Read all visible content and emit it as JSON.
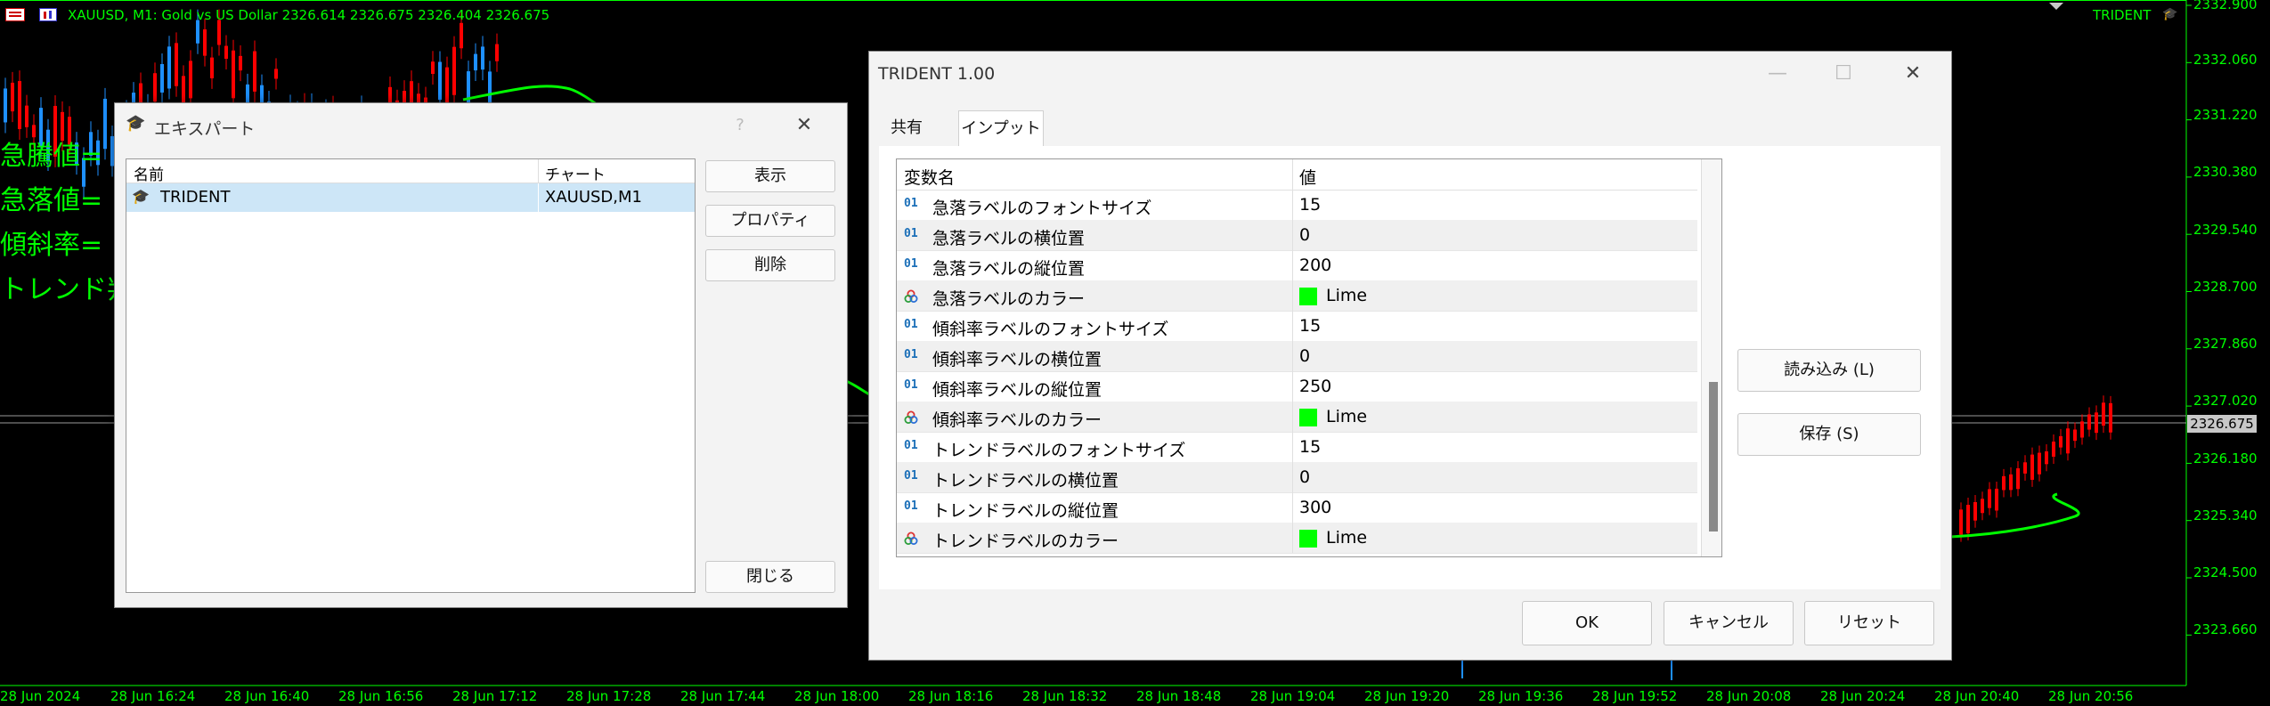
{
  "chart": {
    "title": "XAUUSD, M1:  Gold vs US Dollar  2326.614 2326.675 2326.404 2326.675",
    "indicator_label": "TRIDENT",
    "labels": [
      "急騰値=",
      "急落値=",
      "傾斜率=",
      "トレンド判"
    ],
    "y_ticks": [
      "2332.900",
      "2332.060",
      "2331.220",
      "2330.380",
      "2329.540",
      "2328.700",
      "2327.860",
      "2327.020",
      "2326.180",
      "2325.340",
      "2324.500",
      "2323.660"
    ],
    "current_price": "2326.675",
    "x_ticks": [
      "28 Jun 2024",
      "28 Jun 16:24",
      "28 Jun 16:40",
      "28 Jun 16:56",
      "28 Jun 17:12",
      "28 Jun 17:28",
      "28 Jun 17:44",
      "28 Jun 18:00",
      "28 Jun 18:16",
      "28 Jun 18:32",
      "28 Jun 18:48",
      "28 Jun 19:04",
      "28 Jun 19:20",
      "28 Jun 19:36",
      "28 Jun 19:52",
      "28 Jun 20:08",
      "28 Jun 20:24",
      "28 Jun 20:40",
      "28 Jun 20:56"
    ],
    "colors": {
      "background": "#000000",
      "bull": "#ff0000",
      "bear": "#1e90ff",
      "ma": "#00ff00",
      "text": "#00ff00"
    }
  },
  "expert_window": {
    "title": "エキスパート",
    "help": "?",
    "close": "✕",
    "columns": [
      "名前",
      "チャート"
    ],
    "rows": [
      {
        "name": "TRIDENT",
        "chart": "XAUUSD,M1"
      }
    ],
    "buttons": {
      "show": "表示",
      "properties": "プロパティ",
      "delete": "削除",
      "close": "閉じる"
    }
  },
  "trident_window": {
    "title": "TRIDENT 1.00",
    "minimize": "—",
    "maximize": "☐",
    "close": "✕",
    "tabs": [
      "共有",
      "インプット"
    ],
    "active_tab": "インプット",
    "grid_header": {
      "name": "変数名",
      "value": "値"
    },
    "rows": [
      {
        "type": "int",
        "icon": "01",
        "name": "急落ラベルのフォントサイズ",
        "value": "15"
      },
      {
        "type": "int",
        "icon": "01",
        "name": "急落ラベルの横位置",
        "value": "0"
      },
      {
        "type": "int",
        "icon": "01",
        "name": "急落ラベルの縦位置",
        "value": "200"
      },
      {
        "type": "color",
        "icon": "palette-icon",
        "name": "急落ラベルのカラー",
        "value": "Lime",
        "color": "#00ff00"
      },
      {
        "type": "int",
        "icon": "01",
        "name": "傾斜率ラベルのフォントサイズ",
        "value": "15"
      },
      {
        "type": "int",
        "icon": "01",
        "name": "傾斜率ラベルの横位置",
        "value": "0"
      },
      {
        "type": "int",
        "icon": "01",
        "name": "傾斜率ラベルの縦位置",
        "value": "250"
      },
      {
        "type": "color",
        "icon": "palette-icon",
        "name": "傾斜率ラベルのカラー",
        "value": "Lime",
        "color": "#00ff00"
      },
      {
        "type": "int",
        "icon": "01",
        "name": "トレンドラベルのフォントサイズ",
        "value": "15"
      },
      {
        "type": "int",
        "icon": "01",
        "name": "トレンドラベルの横位置",
        "value": "0"
      },
      {
        "type": "int",
        "icon": "01",
        "name": "トレンドラベルの縦位置",
        "value": "300"
      },
      {
        "type": "color",
        "icon": "palette-icon",
        "name": "トレンドラベルのカラー",
        "value": "Lime",
        "color": "#00ff00"
      }
    ],
    "buttons": {
      "load": "読み込み (L)",
      "save": "保存 (S)",
      "ok": "OK",
      "cancel": "キャンセル",
      "reset": "リセット"
    }
  }
}
